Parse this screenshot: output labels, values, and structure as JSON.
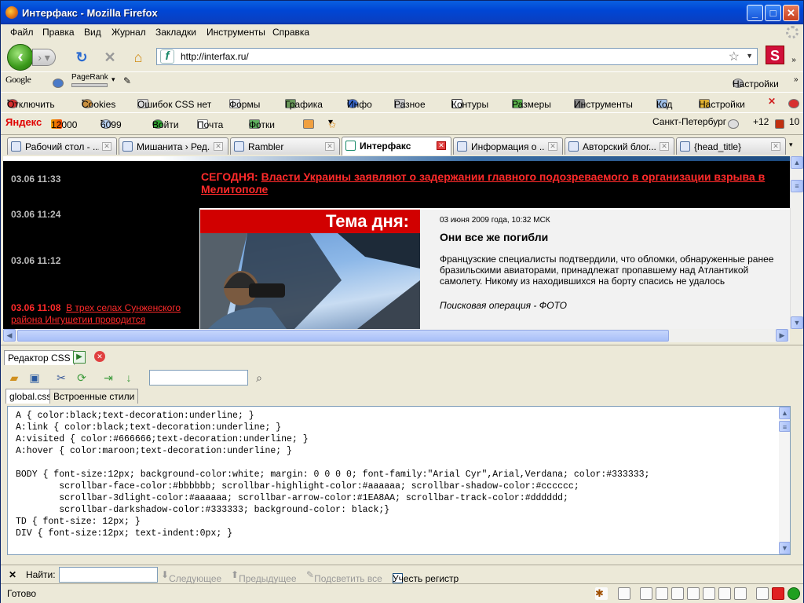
{
  "window": {
    "title": "Интерфакс - Mozilla Firefox"
  },
  "menu": [
    "Файл",
    "Правка",
    "Вид",
    "Журнал",
    "Закладки",
    "Инструменты",
    "Справка"
  ],
  "nav": {
    "url": "http://interfax.ru/",
    "s_button": "S"
  },
  "google_bar": {
    "brand": "Google",
    "pagerank_label": "PageRank",
    "settings": "Настройки"
  },
  "webdev_bar": {
    "items": [
      "Отключить",
      "Cookies",
      "Ошибок CSS нет",
      "Формы",
      "Графика",
      "Инфо",
      "Разное",
      "Контуры",
      "Размеры",
      "Инструменты",
      "Код",
      "Настройки"
    ]
  },
  "yandex_bar": {
    "brand": "Яндекс",
    "rank": "12000",
    "count": "6099",
    "login": "Войти",
    "mail": "Почта",
    "photos": "Фотки",
    "city": "Санкт-Петербург",
    "temp": "+12",
    "traffic": "10"
  },
  "tabs": [
    {
      "label": "Рабочий стол - ...",
      "active": false
    },
    {
      "label": "Мишанита › Ред...",
      "active": false
    },
    {
      "label": "Rambler",
      "active": false
    },
    {
      "label": "Интерфакс",
      "active": true
    },
    {
      "label": "Информация о ...",
      "active": false
    },
    {
      "label": "Авторский блог...",
      "active": false
    },
    {
      "label": "{head_title}",
      "active": false
    }
  ],
  "page": {
    "news": [
      {
        "time": "03.06 11:33",
        "text": ""
      },
      {
        "time": "03.06 11:24",
        "text": ""
      },
      {
        "time": "03.06 11:12",
        "text": ""
      },
      {
        "time": "03.06 11:08",
        "text": "В трех селах Сунженского района Ингушетии проводится"
      }
    ],
    "today_label": "СЕГОДНЯ:",
    "today_link": "Власти Украины заявляют о задержании главного подозреваемого в организации взрыва в Мелитополе",
    "tema_label": "Тема дня:",
    "story_date": "03 июня 2009 года, 10:32 МСК",
    "story_head": "Они все же погибли",
    "story_text": "Французские специалисты подтвердили, что обломки, обнаруженные ранее бразильскими авиаторами, принадлежат пропавшему над Атлантикой самолету. Никому из находившихся на борту спасись не удалось",
    "story_link": "Поисковая операция - ФОТО"
  },
  "css_editor": {
    "title": "Редактор CSS",
    "files": [
      "global.css",
      "Встроенные стили"
    ],
    "code": "A { color:black;text-decoration:underline; }\nA:link { color:black;text-decoration:underline; }\nA:visited { color:#666666;text-decoration:underline; }\nA:hover { color:maroon;text-decoration:underline; }\n\nBODY { font-size:12px; background-color:white; margin: 0 0 0 0; font-family:\"Arial Cyr\",Arial,Verdana; color:#333333;\n        scrollbar-face-color:#bbbbbb; scrollbar-highlight-color:#aaaaaa; scrollbar-shadow-color:#cccccc;\n        scrollbar-3dlight-color:#aaaaaa; scrollbar-arrow-color:#1EA8AA; scrollbar-track-color:#dddddd;\n        scrollbar-darkshadow-color:#333333; background-color: black;}\nTD { font-size: 12px; }\nDIV { font-size:12px; text-indent:0px; }"
  },
  "findbar": {
    "label": "Найти:",
    "next": "Следующее",
    "prev": "Предыдущее",
    "highlight": "Подсветить все",
    "match_case": "Учесть регистр"
  },
  "status": {
    "text": "Готово"
  },
  "colors": {
    "accent_red": "#d10000",
    "title_blue": "#0046d5"
  }
}
